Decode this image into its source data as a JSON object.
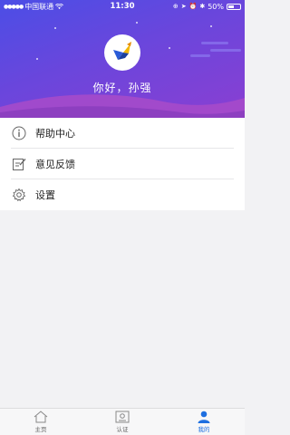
{
  "status_bar": {
    "carrier": "中国联通",
    "time": "11:30",
    "battery": "50%",
    "battery_level": 0.5
  },
  "profile": {
    "greeting": "你好，孙强"
  },
  "menu": {
    "items": [
      {
        "label": "帮助中心",
        "icon": "info-icon"
      },
      {
        "label": "意见反馈",
        "icon": "feedback-icon"
      },
      {
        "label": "设置",
        "icon": "gear-icon"
      }
    ]
  },
  "tabbar": {
    "tabs": [
      {
        "label": "主页",
        "icon": "home-icon",
        "active": false
      },
      {
        "label": "认证",
        "icon": "certificate-icon",
        "active": false
      },
      {
        "label": "我的",
        "icon": "person-icon",
        "active": true
      }
    ]
  },
  "colors": {
    "accent": "#1e6fe0",
    "header_start": "#4b4ee6",
    "header_end": "#8a3fd2"
  }
}
